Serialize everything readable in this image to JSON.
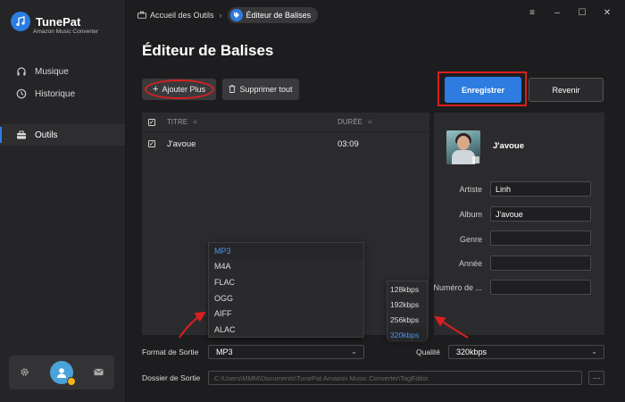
{
  "app": {
    "name": "TunePat",
    "subtitle": "Amazon Music Converter"
  },
  "sidebar": {
    "items": [
      {
        "label": "Musique",
        "icon": "headphones-icon"
      },
      {
        "label": "Historique",
        "icon": "clock-icon"
      },
      {
        "label": "Outils",
        "icon": "toolbox-icon",
        "active": true
      }
    ],
    "bottom_icons": [
      "gear-icon",
      "avatar",
      "mail-icon"
    ]
  },
  "breadcrumb": {
    "home": "Accueil des Outils",
    "current": "Éditeur de Balises"
  },
  "window_controls": [
    "menu-icon",
    "minimize-icon",
    "maximize-icon",
    "close-icon"
  ],
  "page": {
    "title": "Éditeur de Balises"
  },
  "toolbar": {
    "add_label": "Ajouter Plus",
    "delete_label": "Supprimer tout",
    "save_label": "Enregistrer",
    "back_label": "Revenir"
  },
  "table": {
    "headers": {
      "title": "TITRE",
      "duration": "DURÉE"
    },
    "rows": [
      {
        "checked": true,
        "title": "J'avoue",
        "duration": "03:09"
      }
    ]
  },
  "tag_panel": {
    "track_title": "J'avoue",
    "fields": [
      {
        "label": "Artiste",
        "value": "Linh"
      },
      {
        "label": "Album",
        "value": "J'avoue"
      },
      {
        "label": "Genre",
        "value": ""
      },
      {
        "label": "Année",
        "value": ""
      },
      {
        "label": "Numéro de ...",
        "value": ""
      }
    ]
  },
  "format_dropdown": {
    "options": [
      "MP3",
      "M4A",
      "FLAC",
      "OGG",
      "AIFF",
      "ALAC"
    ],
    "selected": "MP3"
  },
  "quality_dropdown": {
    "options": [
      "128kbps",
      "192kbps",
      "256kbps",
      "320kbps"
    ],
    "selected": "320kbps"
  },
  "output": {
    "format_label": "Format de Sortie",
    "format_value": "MP3",
    "quality_label": "Qualité",
    "quality_value": "320kbps",
    "folder_label": "Dossier de Sortie",
    "folder_value": "C:\\Users\\MMM\\Documents\\TunePat Amazon Music Converter\\TagEditor",
    "browse_label": "···"
  },
  "colors": {
    "accent": "#2f7ce0",
    "annotation": "#d9201f",
    "selected_option": "#4c95ee"
  }
}
